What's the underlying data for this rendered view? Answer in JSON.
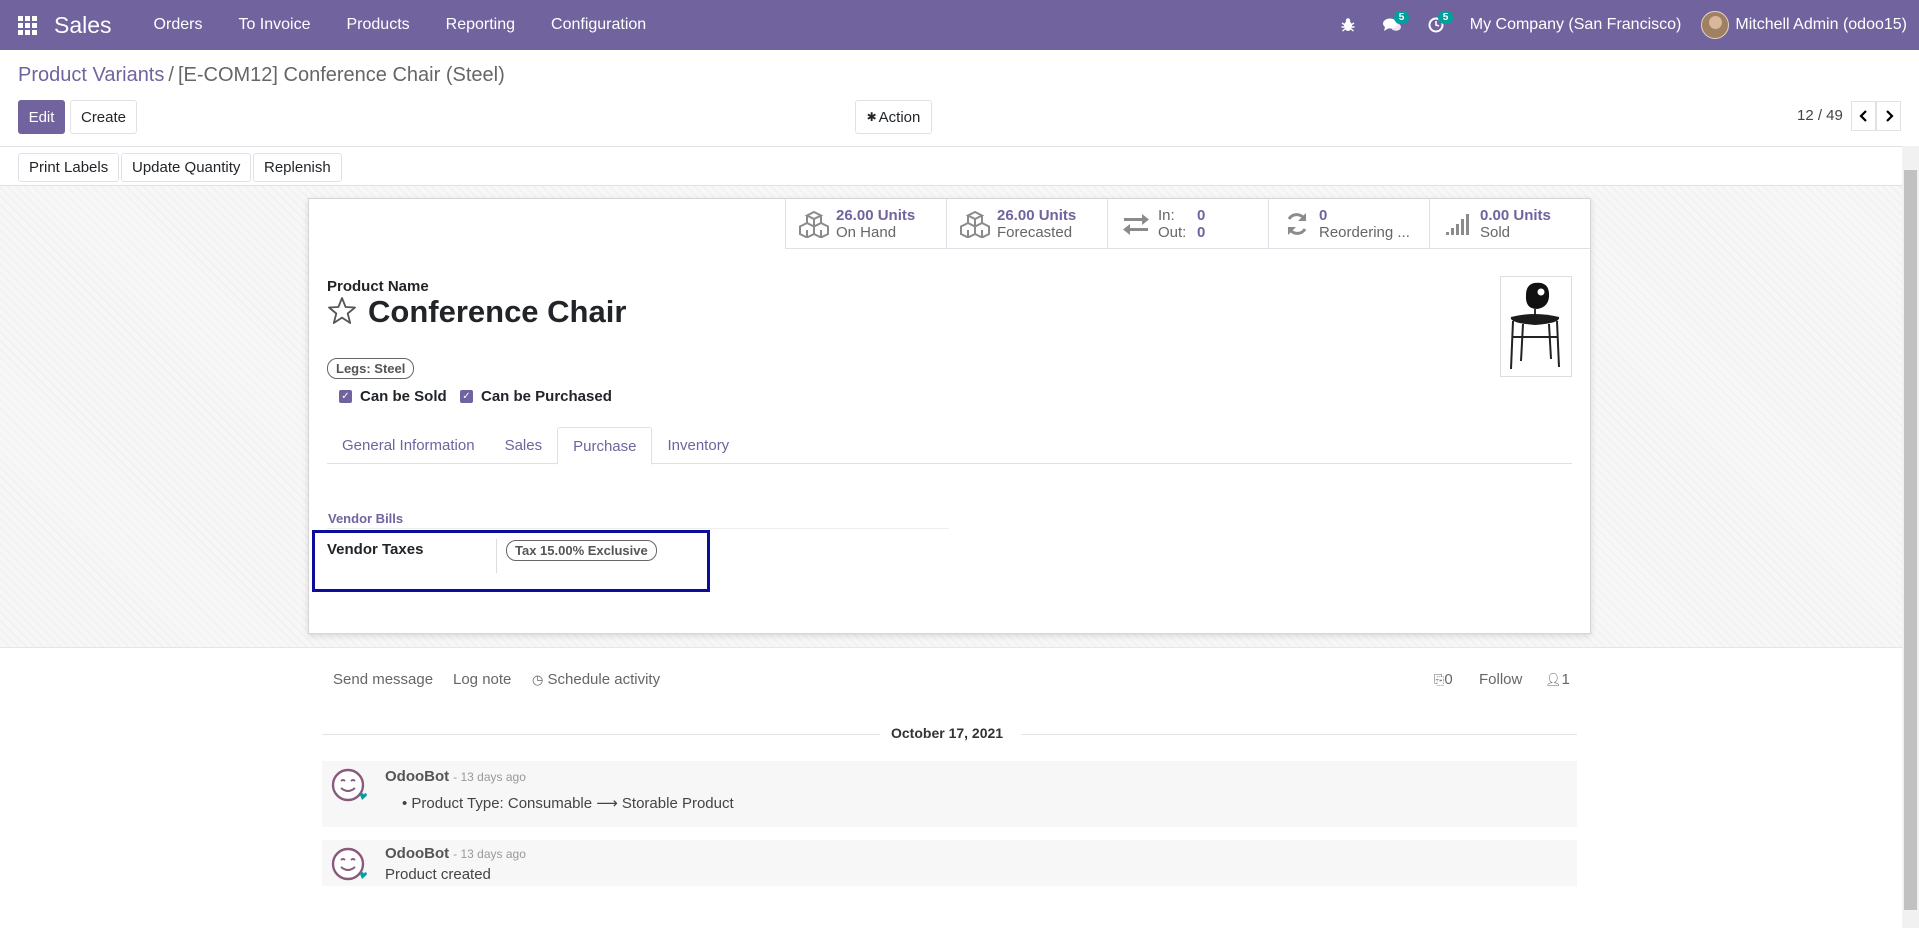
{
  "navbar": {
    "brand": "Sales",
    "menu": [
      "Orders",
      "To Invoice",
      "Products",
      "Reporting",
      "Configuration"
    ],
    "messages_badge": "5",
    "activities_badge": "5",
    "company": "My Company (San Francisco)",
    "user": "Mitchell Admin (odoo15)"
  },
  "breadcrumb": {
    "parent": "Product Variants",
    "separator": "/",
    "current": "[E-COM12] Conference Chair (Steel)"
  },
  "buttons": {
    "edit": "Edit",
    "create": "Create",
    "action": "Action"
  },
  "pager": "12 / 49",
  "statusbar": [
    "Print Labels",
    "Update Quantity",
    "Replenish"
  ],
  "stats": {
    "on_hand": {
      "value": "26.00 Units",
      "label": "On Hand"
    },
    "forecasted": {
      "value": "26.00 Units",
      "label": "Forecasted"
    },
    "in_out": {
      "in_label": "In:",
      "in_value": "0",
      "out_label": "Out:",
      "out_value": "0"
    },
    "reordering": {
      "value": "0",
      "label": "Reordering ..."
    },
    "sold": {
      "value": "0.00 Units",
      "label": "Sold"
    }
  },
  "product": {
    "name_label": "Product Name",
    "name": "Conference Chair",
    "variant_tag": "Legs: Steel",
    "can_be_sold": "Can be Sold",
    "can_be_purchased": "Can be Purchased"
  },
  "tabs": [
    "General Information",
    "Sales",
    "Purchase",
    "Inventory"
  ],
  "active_tab": "Purchase",
  "purchase": {
    "group_title": "Vendor Bills",
    "vendor_taxes_label": "Vendor Taxes",
    "vendor_taxes_tag": "Tax 15.00% Exclusive"
  },
  "chatter": {
    "send_message": "Send message",
    "log_note": "Log note",
    "schedule_activity": "Schedule activity",
    "attachments": "0",
    "follow": "Follow",
    "followers": "1",
    "date": "October 17, 2021",
    "messages": [
      {
        "author": "OdooBot",
        "date": "- 13 days ago",
        "body": "Product Type: Consumable ⟶ Storable Product"
      },
      {
        "author": "OdooBot",
        "date": "- 13 days ago",
        "body": "Product created"
      }
    ]
  },
  "colors": {
    "primary": "#71639e",
    "highlight_box": "#0d0d9b",
    "badge": "#00a09d"
  }
}
